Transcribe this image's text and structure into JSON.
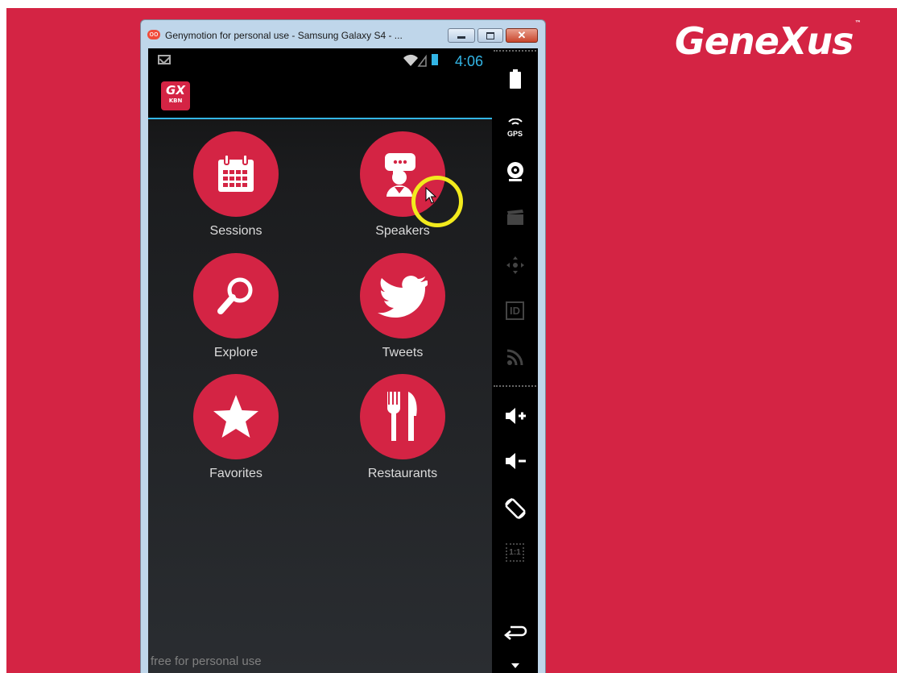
{
  "brand": {
    "name": "GeneXus",
    "tm": "™"
  },
  "window": {
    "title": "Genymotion for personal use - Samsung Galaxy S4 - ...",
    "icon": "genymotion-icon",
    "close_glyph": "✕"
  },
  "status_bar": {
    "time": "4:06",
    "left_icon": "gmail-icon"
  },
  "app": {
    "logo_top": "GX",
    "logo_bottom": "KBN"
  },
  "menu": [
    {
      "label": "Sessions",
      "icon": "calendar-icon"
    },
    {
      "label": "Speakers",
      "icon": "speaker-icon"
    },
    {
      "label": "Explore",
      "icon": "magnifier-icon"
    },
    {
      "label": "Tweets",
      "icon": "twitter-bird-icon"
    },
    {
      "label": "Favorites",
      "icon": "star-icon"
    },
    {
      "label": "Restaurants",
      "icon": "fork-knife-icon"
    }
  ],
  "watermark": "free for personal use",
  "side_toolbar": {
    "gps_label": "GPS",
    "id_label": "ID",
    "scale_label": "1:1",
    "items": [
      "battery-icon",
      "gps-icon",
      "camera-icon",
      "capture-icon",
      "dpad-icon",
      "id-icon",
      "rss-icon",
      "volume-up-icon",
      "volume-down-icon",
      "rotate-icon",
      "scale-icon",
      "back-icon",
      "menu-down-icon"
    ]
  },
  "colors": {
    "brand_red": "#d42444",
    "holo_blue": "#33b5e5",
    "cursor_ring": "#f2ea1d"
  }
}
